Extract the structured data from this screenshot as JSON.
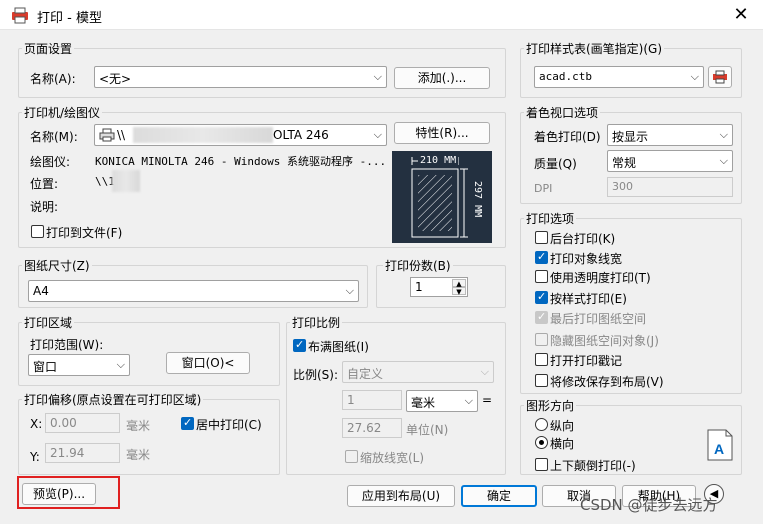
{
  "window": {
    "title": "打印 - 模型",
    "close": "✕"
  },
  "page_setup": {
    "legend": "页面设置",
    "name_label": "名称(A):",
    "name_value": "<无>",
    "add_button": "添加(.)..."
  },
  "plotter": {
    "legend": "打印机/绘图仪",
    "name_label": "名称(M):",
    "name_value_visible": "OLTA 246",
    "name_prefix": "\\\\",
    "properties_button": "特性(R)...",
    "plotter_label": "绘图仪:",
    "plotter_value": "KONICA MINOLTA 246 - Windows 系统驱动程序 -...",
    "location_label": "位置:",
    "location_value": "\\\\1",
    "description_label": "说明:",
    "print_to_file": "打印到文件(F)",
    "print_to_file_checked": false,
    "paper_width": "210 MM",
    "paper_height": "297 MM"
  },
  "paper_size": {
    "legend": "图纸尺寸(Z)",
    "value": "A4"
  },
  "copies": {
    "legend": "打印份数(B)",
    "value": "1"
  },
  "plot_area": {
    "legend": "打印区域",
    "range_label": "打印范围(W):",
    "range_value": "窗口",
    "window_button": "窗口(O)<"
  },
  "plot_offset": {
    "legend": "打印偏移(原点设置在可打印区域)",
    "x_label": "X:",
    "x_value": "0.00",
    "x_unit": "毫米",
    "y_label": "Y:",
    "y_value": "21.94",
    "y_unit": "毫米",
    "center": "居中打印(C)",
    "center_checked": true
  },
  "plot_scale": {
    "legend": "打印比例",
    "fit": "布满图纸(I)",
    "fit_checked": true,
    "scale_label": "比例(S):",
    "scale_value": "自定义",
    "num_value": "1",
    "unit_value": "毫米",
    "equals": "=",
    "units_value": "27.62",
    "units_label": "单位(N)",
    "lineweights": "缩放线宽(L)",
    "lineweights_checked": false
  },
  "plot_style_table": {
    "legend": "打印样式表(画笔指定)(G)",
    "value": "acad.ctb"
  },
  "shaded_viewport": {
    "legend": "着色视口选项",
    "shade_label": "着色打印(D)",
    "shade_value": "按显示",
    "quality_label": "质量(Q)",
    "quality_value": "常规",
    "dpi_label": "DPI",
    "dpi_value": "300"
  },
  "plot_options": {
    "legend": "打印选项",
    "items": [
      {
        "label": "后台打印(K)",
        "checked": false,
        "disabled": false
      },
      {
        "label": "打印对象线宽",
        "checked": true,
        "disabled": false
      },
      {
        "label": "使用透明度打印(T)",
        "checked": false,
        "disabled": false
      },
      {
        "label": "按样式打印(E)",
        "checked": true,
        "disabled": false
      },
      {
        "label": "最后打印图纸空间",
        "checked": true,
        "disabled": true
      },
      {
        "label": "隐藏图纸空间对象(J)",
        "checked": false,
        "disabled": true
      },
      {
        "label": "打开打印戳记",
        "checked": false,
        "disabled": false
      },
      {
        "label": "将修改保存到布局(V)",
        "checked": false,
        "disabled": false
      }
    ]
  },
  "orientation": {
    "legend": "图形方向",
    "portrait": "纵向",
    "landscape": "横向",
    "selected": "landscape",
    "upside_down": "上下颠倒打印(-)",
    "upside_down_checked": false
  },
  "footer": {
    "preview": "预览(P)...",
    "apply_to_layout": "应用到布局(U)",
    "ok": "确定",
    "cancel": "取消",
    "help": "帮助(H)"
  },
  "watermark": "CSDN @徒步去远方",
  "colors": {
    "accent": "#0067c0",
    "preview_bg": "#233040",
    "highlight_box": "#e02020"
  }
}
